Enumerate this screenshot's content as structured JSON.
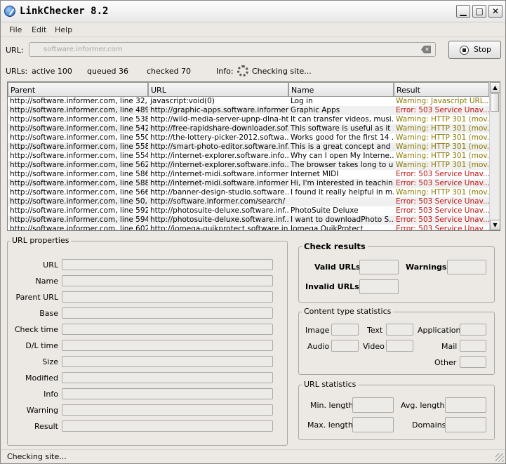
{
  "window": {
    "title": "LinkChecker 8.2"
  },
  "menu": [
    "File",
    "Edit",
    "Help"
  ],
  "url": {
    "label": "URL:",
    "value": "software.informer.com",
    "stop_label": "Stop"
  },
  "stats": {
    "urls_label": "URLs:",
    "active": "active  100",
    "queued": "queued  36",
    "checked": "checked  70",
    "info_label": "Info:",
    "info_value": "Checking site..."
  },
  "table": {
    "headers": [
      "Parent",
      "URL",
      "Name",
      "Result"
    ],
    "rows": [
      {
        "parent": "http://software.informer.com, line 32,...",
        "url": "javascript:void(0)",
        "name": "Log in",
        "result": "Warning: Javascript URL...",
        "kind": "warn"
      },
      {
        "parent": "http://software.informer.com, line 489...",
        "url": "http://graphic-apps.software.informer...",
        "name": "Graphic Apps",
        "result": "Error: 503 Service Unav...",
        "kind": "err"
      },
      {
        "parent": "http://software.informer.com, line 538...",
        "url": "http://wild-media-server-upnp-dlna-ht...",
        "name": "It can transfer videos, musi...",
        "result": "Warning: HTTP 301 (mov...",
        "kind": "warn"
      },
      {
        "parent": "http://software.informer.com, line 542...",
        "url": "http://free-rapidshare-downloader.sof...",
        "name": "This software is useful as it ...",
        "result": "Warning: HTTP 301 (mov...",
        "kind": "warn"
      },
      {
        "parent": "http://software.informer.com, line 550...",
        "url": "http://the-lottery-picker-2012.softwa...",
        "name": "Works good for the first 14 ...",
        "result": "Warning: HTTP 301 (mov...",
        "kind": "warn"
      },
      {
        "parent": "http://software.informer.com, line 558...",
        "url": "http://smart-photo-editor.software.inf...",
        "name": "This is a great concept and ...",
        "result": "Warning: HTTP 301 (mov...",
        "kind": "warn"
      },
      {
        "parent": "http://software.informer.com, line 554...",
        "url": "http://internet-explorer.software.info...",
        "name": "Why can I open My Interne...",
        "result": "Warning: HTTP 301 (mov...",
        "kind": "warn"
      },
      {
        "parent": "http://software.informer.com, line 562...",
        "url": "http://internet-explorer.software.info...",
        "name": "The browser takes long to u...",
        "result": "Warning: HTTP 301 (mov...",
        "kind": "warn"
      },
      {
        "parent": "http://software.informer.com, line 586...",
        "url": "http://internet-midi.software.informer...",
        "name": "Internet MIDI",
        "result": "Error: 503 Service Unav...",
        "kind": "err"
      },
      {
        "parent": "http://software.informer.com, line 588...",
        "url": "http://internet-midi.software.informer...",
        "name": "Hi, I'm interested in teachin...",
        "result": "Error: 503 Service Unav...",
        "kind": "err"
      },
      {
        "parent": "http://software.informer.com, line 566...",
        "url": "http://banner-design-studio.software...",
        "name": "I found it really helpful in m...",
        "result": "Warning: HTTP 301 (mov...",
        "kind": "warn"
      },
      {
        "parent": "http://software.informer.com, line 50,...",
        "url": "http://software.informer.com/search/",
        "name": "",
        "result": "Error: 503 Service Unav...",
        "kind": "err"
      },
      {
        "parent": "http://software.informer.com, line 592...",
        "url": "http://photosuite-deluxe.software.inf...",
        "name": "PhotoSuite Deluxe",
        "result": "Error: 503 Service Unav...",
        "kind": "err"
      },
      {
        "parent": "http://software.informer.com, line 594...",
        "url": "http://photosuite-deluxe.software.inf...",
        "name": "I want to downloadPhoto S...",
        "result": "Error: 503 Service Unav...",
        "kind": "err"
      },
      {
        "parent": "http://software.informer.com, line 602...",
        "url": "http://iomega-quikprotect.software.inf...",
        "name": "Iomega QuikProtect",
        "result": "Error: 503 Service Unav...",
        "kind": "err"
      }
    ]
  },
  "url_properties": {
    "title": "URL properties",
    "labels": [
      "URL",
      "Name",
      "Parent URL",
      "Base",
      "Check time",
      "D/L time",
      "Size",
      "Modified",
      "Info",
      "Warning",
      "Result"
    ]
  },
  "check_results": {
    "title": "Check results",
    "valid": "Valid URLs",
    "warnings": "Warnings",
    "invalid": "Invalid URLs"
  },
  "content_stats": {
    "title": "Content type statistics",
    "image": "Image",
    "text": "Text",
    "application": "Application",
    "audio": "Audio",
    "video": "Video",
    "mail": "Mail",
    "other": "Other"
  },
  "url_stats": {
    "title": "URL statistics",
    "min_length": "Min. length",
    "avg_length": "Avg. length",
    "max_length": "Max. length",
    "domains": "Domains"
  },
  "status": "Checking site..."
}
